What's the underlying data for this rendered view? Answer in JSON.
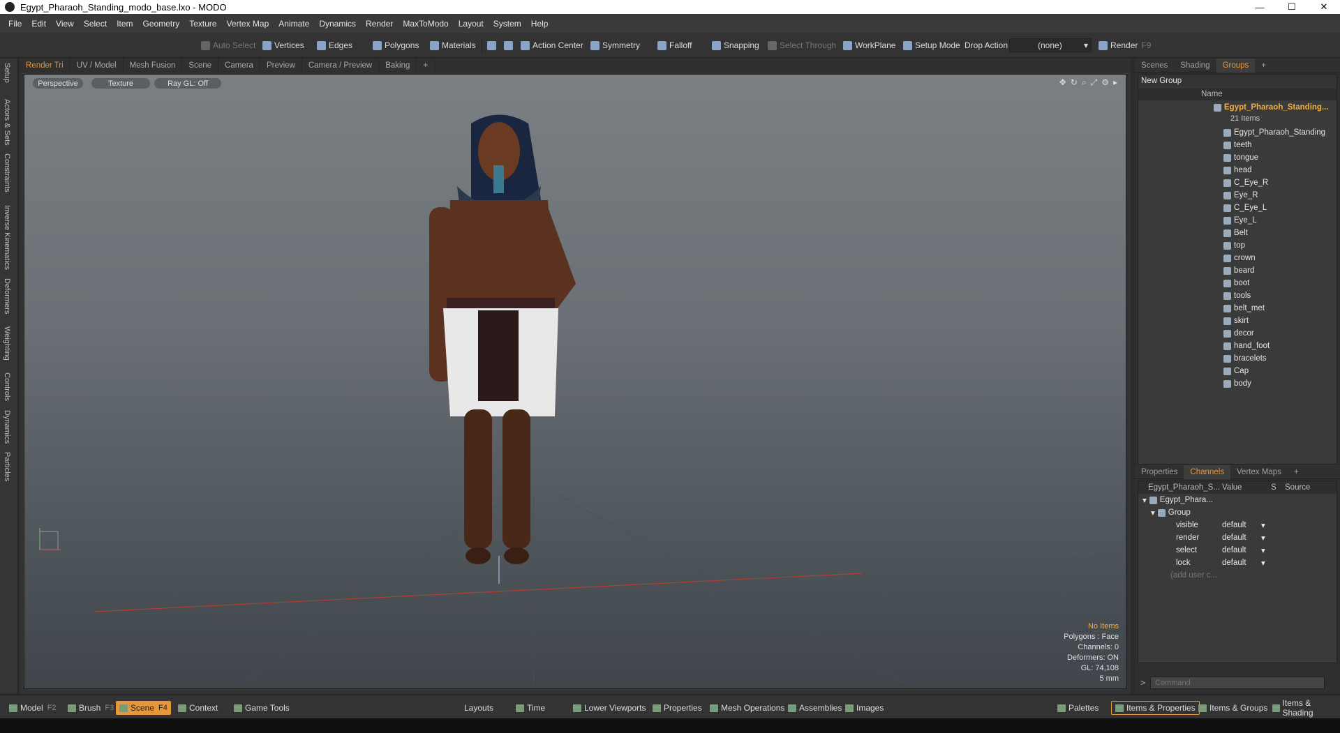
{
  "window": {
    "title": "Egypt_Pharaoh_Standing_modo_base.lxo - MODO",
    "minimize": "—",
    "maximize": "☐",
    "close": "✕"
  },
  "menu": [
    "File",
    "Edit",
    "View",
    "Select",
    "Item",
    "Geometry",
    "Texture",
    "Vertex Map",
    "Animate",
    "Dynamics",
    "Render",
    "MaxToModo",
    "Layout",
    "System",
    "Help"
  ],
  "toolbar": {
    "auto_select": "Auto Select",
    "vertices": "Vertices",
    "edges": "Edges",
    "polygons": "Polygons",
    "materials": "Materials",
    "action_center": "Action Center",
    "symmetry": "Symmetry",
    "falloff": "Falloff",
    "snapping": "Snapping",
    "select_through": "Select Through",
    "workplane": "WorkPlane",
    "setup_mode": "Setup Mode",
    "drop_action": "Drop Action",
    "drop_value": "(none)",
    "render": "Render",
    "render_key": "F9"
  },
  "left_tabs": [
    "Setup",
    "Actors & Sets",
    "Constraints",
    "Inverse Kinematics",
    "Deformers",
    "Weighting",
    "Controls",
    "Dynamics",
    "Particles"
  ],
  "viewport_tabs": [
    "Render Tri",
    "UV / Model",
    "Mesh Fusion",
    "Scene",
    "Camera",
    "Preview",
    "Camera / Preview",
    "Baking",
    "+"
  ],
  "viewport": {
    "perspective": "Perspective",
    "texture": "Texture",
    "raygl": "Ray GL: Off"
  },
  "stats": {
    "items": "No Items",
    "polygons": "Polygons : Face",
    "channels": "Channels: 0",
    "deformers": "Deformers: ON",
    "gl": "GL: 74,108",
    "scale": "5 mm"
  },
  "right_tabs": [
    "Scenes",
    "Shading",
    "Groups",
    "+"
  ],
  "groups": {
    "new_group": "New Group",
    "col_name": "Name",
    "root": "Egypt_Pharaoh_Standing...",
    "count": "21 Items",
    "items": [
      "Egypt_Pharaoh_Standing",
      "teeth",
      "tongue",
      "head",
      "C_Eye_R",
      "Eye_R",
      "C_Eye_L",
      "Eye_L",
      "Belt",
      "top",
      "crown",
      "beard",
      "boot",
      "tools",
      "belt_met",
      "skirt",
      "decor",
      "hand_foot",
      "bracelets",
      "Cap",
      "body"
    ]
  },
  "channel_tabs": [
    "Properties",
    "Channels",
    "Vertex Maps",
    "+"
  ],
  "channels": {
    "col_item": "Egypt_Pharaoh_S...",
    "col_value": "Value",
    "col_s": "S",
    "col_source": "Source",
    "item": "Egypt_Phara...",
    "group": "Group",
    "rows": [
      {
        "name": "visible",
        "value": "default"
      },
      {
        "name": "render",
        "value": "default"
      },
      {
        "name": "select",
        "value": "default"
      },
      {
        "name": "lock",
        "value": "default"
      }
    ],
    "add": "(add user c..."
  },
  "command": {
    "prompt": ">",
    "placeholder": "Command"
  },
  "bottom": {
    "model": "Model",
    "model_key": "F2",
    "brush": "Brush",
    "brush_key": "F3",
    "scene": "Scene",
    "scene_key": "F4",
    "context": "Context",
    "game_tools": "Game Tools",
    "layouts": "Layouts",
    "time": "Time",
    "lower_viewports": "Lower Viewports",
    "properties": "Properties",
    "mesh_operations": "Mesh Operations",
    "assemblies": "Assemblies",
    "images": "Images",
    "palettes": "Palettes",
    "items_properties": "Items & Properties",
    "items_groups": "Items & Groups",
    "items_shading": "Items & Shading"
  }
}
